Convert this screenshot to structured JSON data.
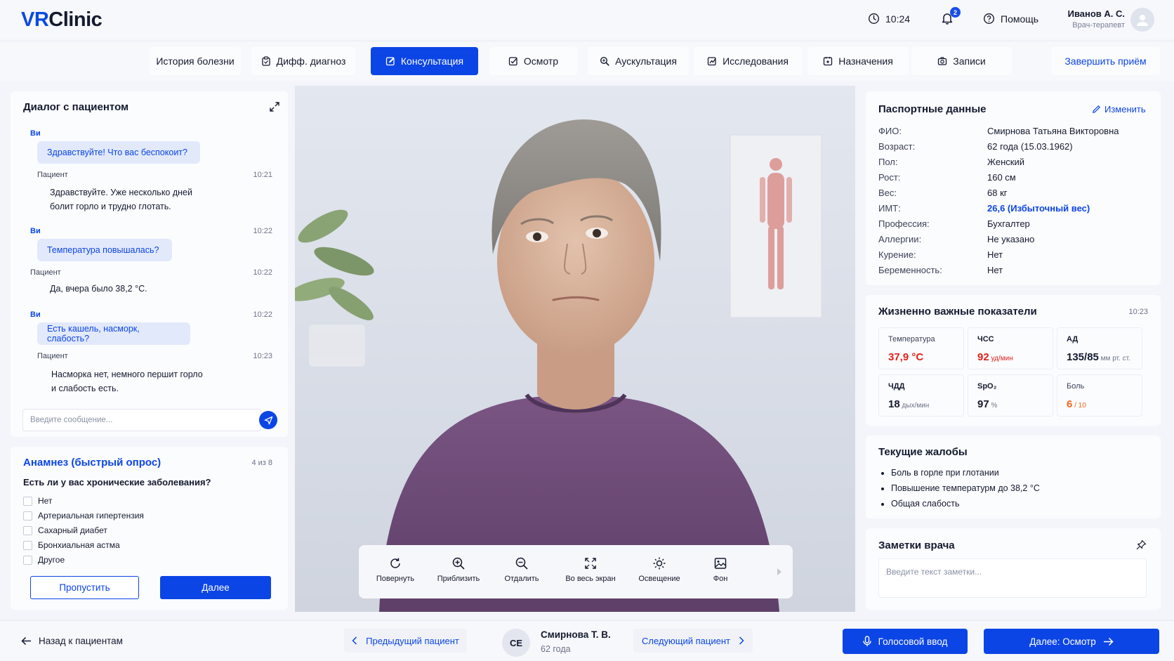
{
  "header": {
    "logo_vr": "VR",
    "logo_clinic": "Clinic",
    "time": "10:24",
    "notifications_count": "2",
    "help_label": "Помощь",
    "user_name": "Иванов А. С.",
    "user_role": "Врач-терапевт"
  },
  "tabs": [
    {
      "label": "История болезни",
      "icon": "none"
    },
    {
      "label": "Дифф. диагноз",
      "icon": "clipboard-icon"
    },
    {
      "label": "Консультация",
      "icon": "edit-icon",
      "active": true
    },
    {
      "label": "Осмотр",
      "icon": "checklist-icon"
    },
    {
      "label": "Аускультация",
      "icon": "search-zoom-icon"
    },
    {
      "label": "Исследования",
      "icon": "chart-icon"
    },
    {
      "label": "Назначения",
      "icon": "prescription-icon"
    },
    {
      "label": "Записи",
      "icon": "camera-icon"
    }
  ],
  "finish_label": "Завершить приём",
  "chat": {
    "title": "Диалог с пациентом",
    "messages": [
      {
        "who": "Ви",
        "text": "Здравствуйте! Что вас беспокоит?",
        "time": ""
      },
      {
        "who": "Пациент",
        "text_lines": [
          "Здравствуйте. Уже несколько дней",
          "болит горло и трудно глотать."
        ],
        "time": "10:21"
      },
      {
        "who": "Ви",
        "text": "Температура повышалась?",
        "time": "10:22"
      },
      {
        "who": "Пациент",
        "text_lines": [
          "Да, вчера было 38,2 °С."
        ],
        "time": "10:22"
      },
      {
        "who": "Ви",
        "text": "Есть кашель, насморк, слабость?",
        "time": "10:22"
      },
      {
        "who": "Пациент",
        "text_lines": [
          "Насморка нет, немного першит горло",
          "и слабость есть."
        ],
        "time": "10:23"
      }
    ],
    "input_placeholder": "Введите сообщение..."
  },
  "anamnesis": {
    "title": "Анамнез (быстрый опрос)",
    "counter": "4 из 8",
    "question": "Есть ли у вас хронические заболевания?",
    "options": [
      "Нет",
      "Артериальная гипертензия",
      "Сахарный диабет",
      "Бронхиальная астма",
      "Другое"
    ],
    "skip_label": "Пропустить",
    "next_label": "Далее"
  },
  "toolbar": [
    {
      "label": "Повернуть",
      "icon": "rotate-icon"
    },
    {
      "label": "Приблизить",
      "icon": "zoom-in-icon"
    },
    {
      "label": "Отдалить",
      "icon": "zoom-out-icon"
    },
    {
      "label": "Во весь экран",
      "icon": "fullscreen-icon"
    },
    {
      "label": "Освещение",
      "icon": "sun-icon"
    },
    {
      "label": "Фон",
      "icon": "image-icon"
    }
  ],
  "passport": {
    "title": "Паспортные данные",
    "edit_label": "Изменить",
    "rows": [
      {
        "label": "ФИО:",
        "value": "Смирнова Татьяна Викторовна"
      },
      {
        "label": "Возраст:",
        "value": "62 года (15.03.1962)"
      },
      {
        "label": "Пол:",
        "value": "Женский"
      },
      {
        "label": "Рост:",
        "value": "160 см"
      },
      {
        "label": "Вес:",
        "value": "68 кг"
      },
      {
        "label": "ИМТ:",
        "value": "26,6 (Избыточный вес)",
        "link": true
      },
      {
        "label": "Профессия:",
        "value": "Бухгалтер"
      },
      {
        "label": "Аллергии:",
        "value": "Не указано"
      },
      {
        "label": "Курение:",
        "value": "Нет"
      },
      {
        "label": "Беременность:",
        "value": "Нет"
      }
    ]
  },
  "vitals": {
    "title": "Жизненно важные показатели",
    "time": "10:23",
    "items": [
      {
        "label": "Температура",
        "value": "37,9 °С",
        "unit": "",
        "status": "red"
      },
      {
        "label": "ЧСС",
        "value": "92",
        "unit": " уд/мин",
        "status": "red"
      },
      {
        "label": "АД",
        "value": "135/85",
        "unit": " мм рт. ст.",
        "status": "normal"
      },
      {
        "label": "ЧДД",
        "value": "18",
        "unit": " дых/мин",
        "status": "normal"
      },
      {
        "label": "SpO₂",
        "value": "97",
        "unit": " %",
        "status": "normal"
      },
      {
        "label": "Боль",
        "value": "6",
        "unit": " / 10",
        "status": "orange"
      }
    ]
  },
  "complaints": {
    "title": "Текущие жалобы",
    "items": [
      "Боль в горле при глотании",
      "Повышение температурм до 38,2 °С",
      "Общая слабость"
    ]
  },
  "notes": {
    "title": "Заметки врача",
    "placeholder": "Введите текст заметки..."
  },
  "footer": {
    "back_label": "Назад к пациентам",
    "prev_label": "Предыдущий пациент",
    "patient_initials": "СЕ",
    "patient_name": "Смирнова Т. В.",
    "patient_age": "62 года",
    "next_patient_label": "Следующий пациент",
    "voice_label": "Голосовой ввод",
    "next_exam_label": "Далее: Осмотр"
  },
  "colors": {
    "accent": "#0c45e6",
    "danger": "#e0211c",
    "warning": "#f0671b"
  }
}
